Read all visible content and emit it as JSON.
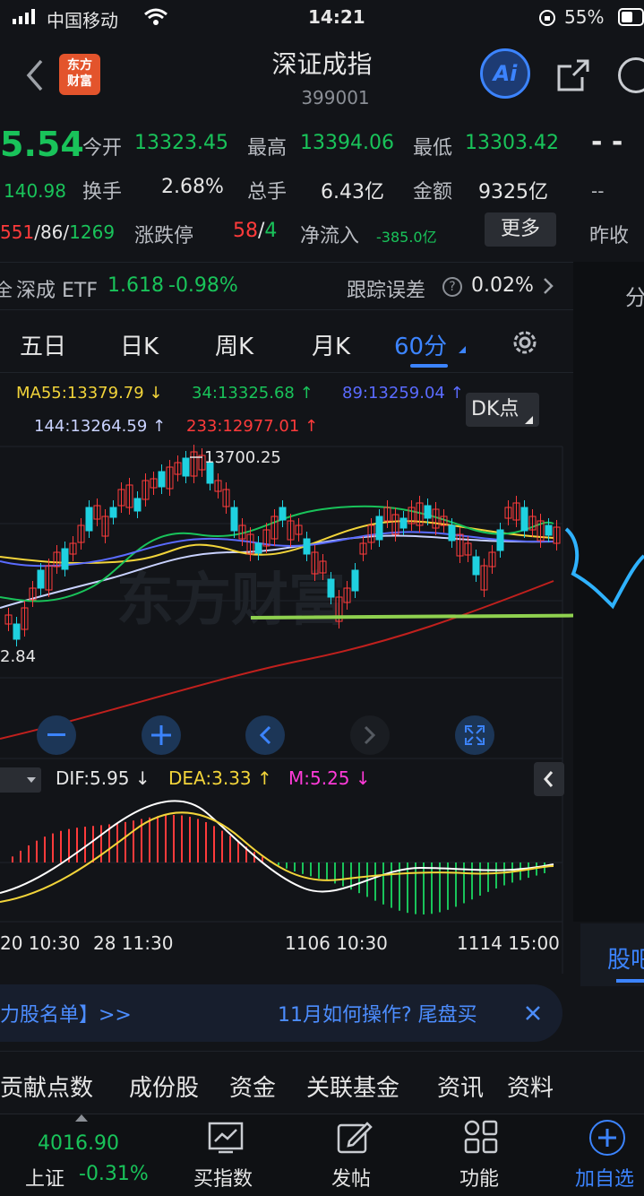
{
  "status": {
    "carrier": "中国移动",
    "time": "14:21",
    "battery": "55%"
  },
  "nav": {
    "title": "深证成指",
    "code": "399001",
    "logo_line1": "东方",
    "logo_line2": "财富",
    "ai": "Ai"
  },
  "quote": {
    "price": "5.54",
    "change": "140.98",
    "updown": {
      "up": "551",
      "flat": "86",
      "down": "1269"
    },
    "today_open_label": "今开",
    "today_open": "13323.45",
    "high_label": "最高",
    "high": "13394.06",
    "low_label": "最低",
    "low": "13303.42",
    "turnover_label": "换手",
    "turnover": "2.68%",
    "volume_label": "总手",
    "volume": "6.43亿",
    "amount_label": "金额",
    "amount": "9325亿",
    "limit_label": "涨跌停",
    "limit_up": "58",
    "limit_down": "4",
    "netflow_label": "净流入",
    "netflow": "-385.0亿",
    "more": "更多",
    "right_top": "- -",
    "right_mid": "--",
    "right_label": "昨收"
  },
  "etf": {
    "name": "深成 ETF",
    "price": "1.618",
    "pct": "-0.98%",
    "track_label": "跟踪误差",
    "track_value": "0.02%"
  },
  "right_side": {
    "label1": "分",
    "label2": "股吧"
  },
  "tabs": [
    "五日",
    "日K",
    "周K",
    "月K",
    "60分"
  ],
  "ma": {
    "ma55": "MA55:13379.79 ↓",
    "ma34": "34:13325.68 ↑",
    "ma89": "89:13259.04 ↑",
    "ma144": "144:13264.59 ↑",
    "ma233": "233:12977.01 ↑",
    "dk": "DK点"
  },
  "chart_data": {
    "type": "candlestick",
    "high_label": "13700.25",
    "low_label": "2.84",
    "macd": {
      "dif": "DIF:5.95 ↓",
      "dea": "DEA:3.33 ↑",
      "m": "M:5.25 ↓"
    },
    "x_labels": [
      "20 10:30",
      "28 11:30",
      "1106 10:30",
      "1114 15:00"
    ]
  },
  "ad": {
    "left": "力股名单】>>",
    "right": "11月如何操作? 尾盘买"
  },
  "bottom_tabs": [
    "贡献点数",
    "成份股",
    "资金",
    "关联基金",
    "资讯",
    "资料"
  ],
  "tabbar": {
    "index_value": "4016.90",
    "index_name": "上证",
    "index_pct": "-0.31%",
    "buy": "买指数",
    "post": "发帖",
    "func": "功能",
    "add": "加自选"
  }
}
